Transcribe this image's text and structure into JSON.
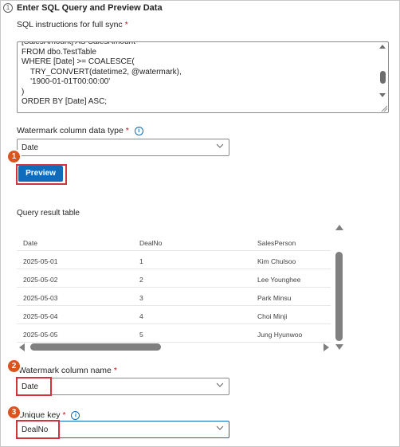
{
  "step_number": "1",
  "section_title": "Enter SQL Query and Preview Data",
  "sql": {
    "label": "SQL instructions for full sync",
    "required_mark": "*",
    "text": "[SalesAmount] AS SalesAmount\nFROM dbo.TestTable\nWHERE [Date] >= COALESCE(\n    TRY_CONVERT(datetime2, @watermark),\n    '1900-01-01T00:00:00'\n)\nORDER BY [Date] ASC;"
  },
  "watermark_type": {
    "label": "Watermark column data type",
    "required_mark": "*",
    "value": "Date"
  },
  "preview_button": "Preview",
  "query_result": {
    "label": "Query result table",
    "columns": [
      "Date",
      "DealNo",
      "SalesPerson"
    ],
    "rows": [
      [
        "2025-05-01",
        "1",
        "Kim Chulsoo"
      ],
      [
        "2025-05-02",
        "2",
        "Lee Younghee"
      ],
      [
        "2025-05-03",
        "3",
        "Park Minsu"
      ],
      [
        "2025-05-04",
        "4",
        "Choi Minji"
      ],
      [
        "2025-05-05",
        "5",
        "Jung Hyunwoo"
      ]
    ]
  },
  "watermark_name": {
    "label": "Watermark column name",
    "required_mark": "*",
    "value": "Date"
  },
  "unique_key": {
    "label": "Unique key",
    "required_mark": "*",
    "value": "DealNo"
  },
  "badges": [
    "1",
    "2",
    "3"
  ],
  "colors": {
    "accent": "#0f6cbd",
    "highlight": "#d13438",
    "badge": "#d9541e",
    "required": "#c50f1f"
  }
}
